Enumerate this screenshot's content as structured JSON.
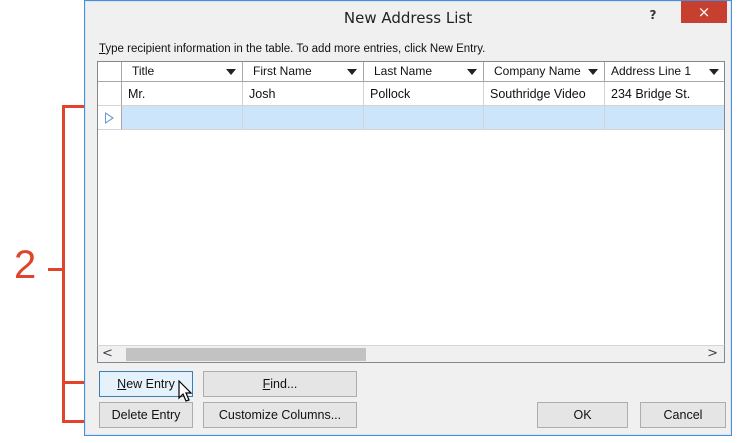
{
  "dialog": {
    "title": "New Address List",
    "help": "?",
    "close": "×",
    "instruction": "Type recipient information in the table.  To add more entries, click New Entry.",
    "instruction_mnemonic": "T",
    "instruction_rest": "ype recipient information in the table.  To add more entries, click New Entry."
  },
  "grid": {
    "columns": [
      "Title",
      "First Name",
      "Last Name",
      "Company Name",
      "Address Line 1"
    ],
    "rows": [
      [
        "Mr.",
        "Josh",
        "Pollock",
        "Southridge Video",
        "234 Bridge St."
      ]
    ]
  },
  "scrollbar": {
    "left": "<",
    "right": ">"
  },
  "buttons": {
    "new_entry_mnemonic": "N",
    "new_entry_rest": "ew Entry",
    "find_mnemonic": "F",
    "find_rest": "ind...",
    "delete_entry": "Delete Entry",
    "customize_pre": "Customize Columns...",
    "ok": "OK",
    "cancel": "Cancel"
  },
  "annotation": {
    "step_number": "2",
    "color": "#e0452c"
  }
}
